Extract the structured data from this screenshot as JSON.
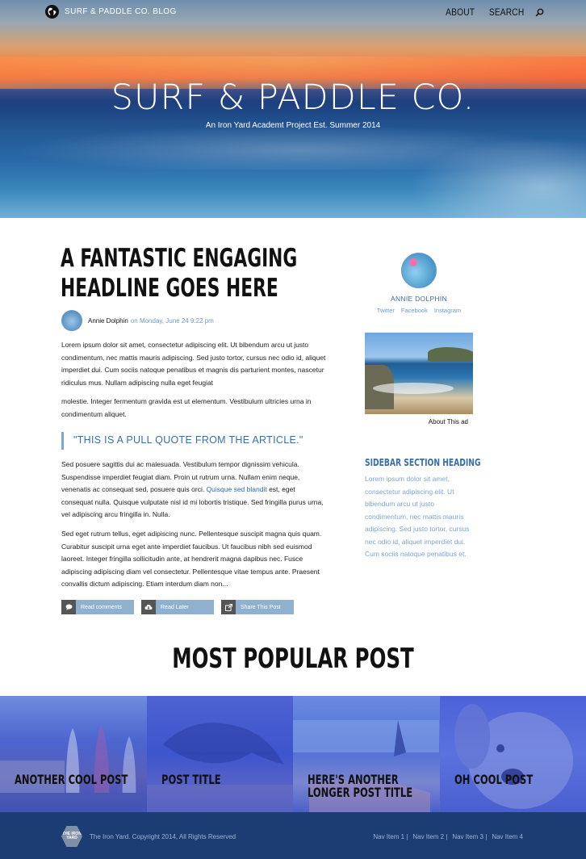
{
  "topbar": {
    "blog_name": "SURF & PADDLE CO. BLOG",
    "nav": [
      "ABOUT",
      "SEARCH"
    ],
    "icons": [
      "globe-icon",
      "search-icon"
    ]
  },
  "hero": {
    "title": "SURF & PADDLE CO.",
    "subtitle": "An Iron Yard Academt Project Est. Summer 2014"
  },
  "article": {
    "headline": "A FANTASTIC ENGAGING HEADLINE GOES HERE",
    "author": "Annie Dolphin",
    "date": "on Monday, June 24 9:22 pm",
    "p1": "Lorem ipsum dolor sit amet, consectetur adipiscing elit. Ut bibendum arcu ut justo condimentum, nec mattis mauris adipiscing. Sed justo tortor, cursus nec odio id, aliquet imperdiet dui. Cum sociis natoque penatibus et magnis dis parturient montes, nascetur ridiculus mus. Nullam adipiscing nulla eget feugiat",
    "p2": "molestie. Integer fermentum gravida est ut elementum. Vestibulum ultricies urna in condimentum aliquet.",
    "pull_quote": "\"THIS IS A PULL QUOTE FROM THE ARTICLE.\"",
    "p3_before": "Sed posuere sagittis dui ac malesuada. Vestibulum tempor dignissim vehicula. Suspendisse imperdiet feugiat diam. Proin ut rutrum urna. Nullam enim neque, venenatis ac consequat sed, posuere quis orci. ",
    "p3_link": "Quisque sed blandit",
    "p3_after": " est, eget consequat nulla. Quisque vulputate nisl id mi lobortis tristique. Sed fringilla purus urna, vel adipiscing arcu fringilla in. Nulla.",
    "p4": "Sed eget rutrum tellus, eget adipiscing nunc. Pellentesque suscipit magna quis quam. Curabitur suscipit urna eget ante imperdiet faucibus. Ut faucibus nibh sed euismod laoreet. Integer fringilla sollicitudin ante, at hendrerit magna dapibus nec. Fusce adipiscing adipiscing diam vel consectetur. Pellentesque vitae tempus ante. Praesent convallis dictum adipiscing. Etiam interdum diam non...",
    "actions": [
      {
        "label": "Read comments",
        "icon": "comment-icon"
      },
      {
        "label": "Read Later",
        "icon": "cloud-download-icon"
      },
      {
        "label": "Share This Post",
        "icon": "share-icon"
      }
    ]
  },
  "sidebar": {
    "name": "ANNIE DOLPHIN",
    "social": [
      "Twitter",
      "Facebook",
      "Instagram"
    ],
    "ad_label": "About This ad",
    "heading": "SIDEBAR SECTION HEADING",
    "text": "Lorem ipsum dolor sit amet, consectetur adipiscing elit. Ut bibendum arcu ut justo condimentum, nec mattis mauris adipiscing. Sed justo tortor, cursus nec odio id, aliquet imperdiet dui. Cum sociis natoque penatibus et."
  },
  "popular": {
    "heading": "MOST POPULAR POST",
    "cards": [
      {
        "title": "ANOTHER COOL POST"
      },
      {
        "title": "POST TITLE"
      },
      {
        "title": "HERE'S ANOTHER LONGER POST TITLE"
      },
      {
        "title": "OH COOL POST"
      }
    ]
  },
  "footer": {
    "logo_text": "THE IRON YARD",
    "copyright": "The Iron Yard. Copyright 2014, All Rights Reserved",
    "nav": [
      "Nav Item 1 |",
      "Nav Item 2 |",
      "Nav Item 3 |",
      "Nav Item 4"
    ]
  },
  "colors": {
    "accent": "#3a6ea8",
    "link": "#2a6cc8",
    "footer_bg": "#1b3d73",
    "popular_tint": "#3f55d6",
    "button_bg": "#8fb0cf"
  }
}
